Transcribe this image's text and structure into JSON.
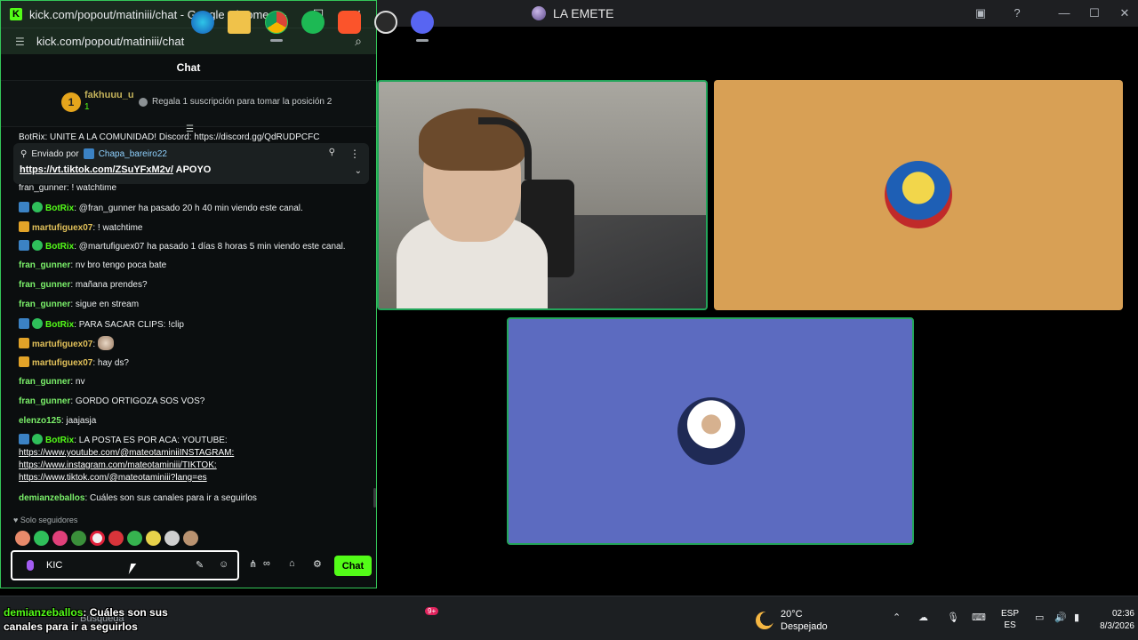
{
  "browser": {
    "window_title": "kick.com/popout/matiniii/chat - Google Chrome",
    "url": "kick.com/popout/matiniii/chat",
    "controls": {
      "minimize": "—",
      "maximize": "☐",
      "close": "✕"
    }
  },
  "chat": {
    "header": "Chat",
    "leaderboard": {
      "rank": "1",
      "username": "fakhuuu_u",
      "count": "1",
      "gift_hint": "Regala 1 suscripción para tomar la posición 2"
    },
    "partial_top_message": "BotRix: UNITE A LA COMUNIDAD! Discord: https://discord.gg/QdRUDPCFC",
    "pinned": {
      "sent_by_label": "Enviado por",
      "sent_by_user": "Chapa_bareiro22",
      "link": "https://vt.tiktok.com/ZSuYFxM2v/",
      "text": "APOYO"
    },
    "partial_hidden_message": "fran_gunner: ! watchtime",
    "messages": [
      {
        "user": "BotRix",
        "text": ": @fran_gunner ha pasado 20 h 40 min viendo este canal."
      },
      {
        "user": "martufiguex07",
        "text": ": ! watchtime"
      },
      {
        "user": "BotRix",
        "text": ": @martufiguex07 ha pasado 1 días 8 horas 5 min viendo este canal."
      },
      {
        "user": "fran_gunner",
        "text": ": nv bro tengo poca bate"
      },
      {
        "user": "fran_gunner",
        "text": ": mañana prendes?"
      },
      {
        "user": "fran_gunner",
        "text": ": sigue en stream"
      },
      {
        "user": "BotRix",
        "text": ": PARA SACAR CLIPS: !clip"
      },
      {
        "user": "martufiguex07",
        "text": ":"
      },
      {
        "user": "martufiguex07",
        "text": ": hay ds?"
      },
      {
        "user": "fran_gunner",
        "text": ": nv"
      },
      {
        "user": "fran_gunner",
        "text": ": GORDO ORTIGOZA SOS VOS?"
      },
      {
        "user": "elenzo125",
        "text": ": jaajasja"
      },
      {
        "user": "BotRix",
        "text": ": LA POSTA ES POR ACA: YOUTUBE:"
      },
      {
        "user": "demianzeballos",
        "text": ": Cuáles son sus canales para ir a seguirlos"
      }
    ],
    "botrix_links": [
      "https://www.youtube.com/@mateotaminiiINSTAGRAM:",
      "https://www.instagram.com/mateotaminiii/TIKTOK:",
      "https://www.tiktok.com/@mateotaminiii?lang=es"
    ],
    "followers_only": "Solo seguidores",
    "input_value": "KIC",
    "send_label": "Chat"
  },
  "discord": {
    "title": "LA EMETE"
  },
  "overlay": {
    "username": "demianzeballos",
    "text": ": Cuáles son sus canales para ir a seguirlos"
  },
  "taskbar": {
    "search": "Búsqueda",
    "weather_temp": "20°C",
    "weather_desc": "Despejado",
    "lang_top": "ESP",
    "lang_bottom": "ES",
    "time": "02:36",
    "date": "8/3/2026",
    "discord_badge": "9+"
  },
  "colors": {
    "kick_green": "#53fc18",
    "discord_blurple": "#5865f2",
    "speaking_green": "#23a55a"
  }
}
